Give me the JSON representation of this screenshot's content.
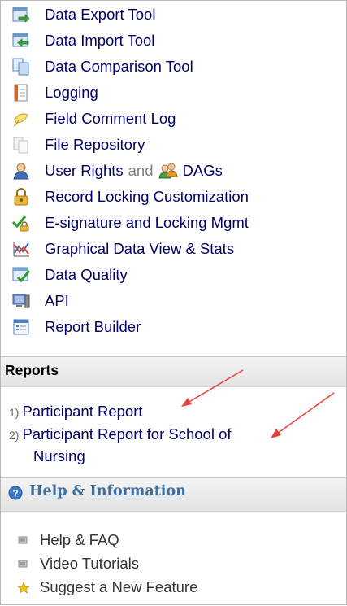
{
  "tools": [
    {
      "label": "Data Export Tool",
      "icon": "data-export-icon"
    },
    {
      "label": "Data Import Tool",
      "icon": "data-import-icon"
    },
    {
      "label": "Data Comparison Tool",
      "icon": "data-comparison-icon"
    },
    {
      "label": "Logging",
      "icon": "logging-icon"
    },
    {
      "label": "Field Comment Log",
      "icon": "field-comment-icon"
    },
    {
      "label": "File Repository",
      "icon": "file-repository-icon"
    },
    {
      "label": "User Rights",
      "and": "and",
      "label2": "DAGs",
      "icon": "user-rights-icon",
      "icon2": "dags-icon"
    },
    {
      "label": "Record Locking Customization",
      "icon": "record-locking-icon"
    },
    {
      "label": "E-signature and Locking Mgmt",
      "icon": "esignature-icon"
    },
    {
      "label": "Graphical Data View & Stats",
      "icon": "graphical-data-icon"
    },
    {
      "label": "Data Quality",
      "icon": "data-quality-icon"
    },
    {
      "label": "API",
      "icon": "api-icon"
    },
    {
      "label": "Report Builder",
      "icon": "report-builder-icon"
    }
  ],
  "reports": {
    "title": "Reports",
    "items": [
      {
        "num": "1)",
        "label": "Participant Report"
      },
      {
        "num": "2)",
        "label": "Participant Report for School of",
        "label_cont": "Nursing"
      }
    ]
  },
  "help": {
    "title": "Help & Information",
    "items": [
      {
        "label": "Help & FAQ",
        "icon": "help-faq-bullet-icon"
      },
      {
        "label": "Video Tutorials",
        "icon": "video-tutorials-bullet-icon"
      },
      {
        "label": "Suggest a New Feature",
        "icon": "star-icon"
      }
    ]
  },
  "colors": {
    "link": "#000066",
    "help_title": "#3d6d9a",
    "arrow": "#e8413a"
  }
}
